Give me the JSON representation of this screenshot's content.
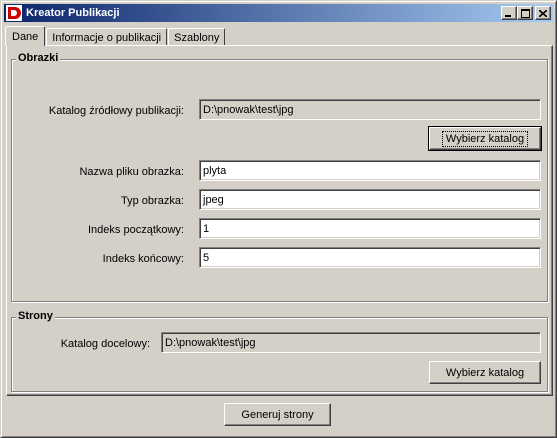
{
  "window": {
    "title": "Kreator Publikacji",
    "controls": {
      "minimize_icon": "minimize-icon",
      "maximize_icon": "maximize-icon",
      "close_icon": "close-icon"
    }
  },
  "tabs": [
    {
      "label": "Dane",
      "active": true
    },
    {
      "label": "Informacje o publikacji",
      "active": false
    },
    {
      "label": "Szablony",
      "active": false
    }
  ],
  "images_group": {
    "title": "Obrazki",
    "source_dir_label": "Katalog źródłowy publikacji:",
    "source_dir_value": "D:\\pnowak\\test\\jpg",
    "browse_button": "Wybierz katalog",
    "filename_label": "Nazwa pliku obrazka:",
    "filename_value": "plyta",
    "type_label": "Typ obrazka:",
    "type_value": "jpeg",
    "start_index_label": "Indeks początkowy:",
    "start_index_value": "1",
    "end_index_label": "Indeks końcowy:",
    "end_index_value": "5"
  },
  "pages_group": {
    "title": "Strony",
    "target_dir_label": "Katalog docelowy:",
    "target_dir_value": "D:\\pnowak\\test\\jpg",
    "browse_button": "Wybierz katalog"
  },
  "footer": {
    "generate_button": "Generuj strony"
  }
}
